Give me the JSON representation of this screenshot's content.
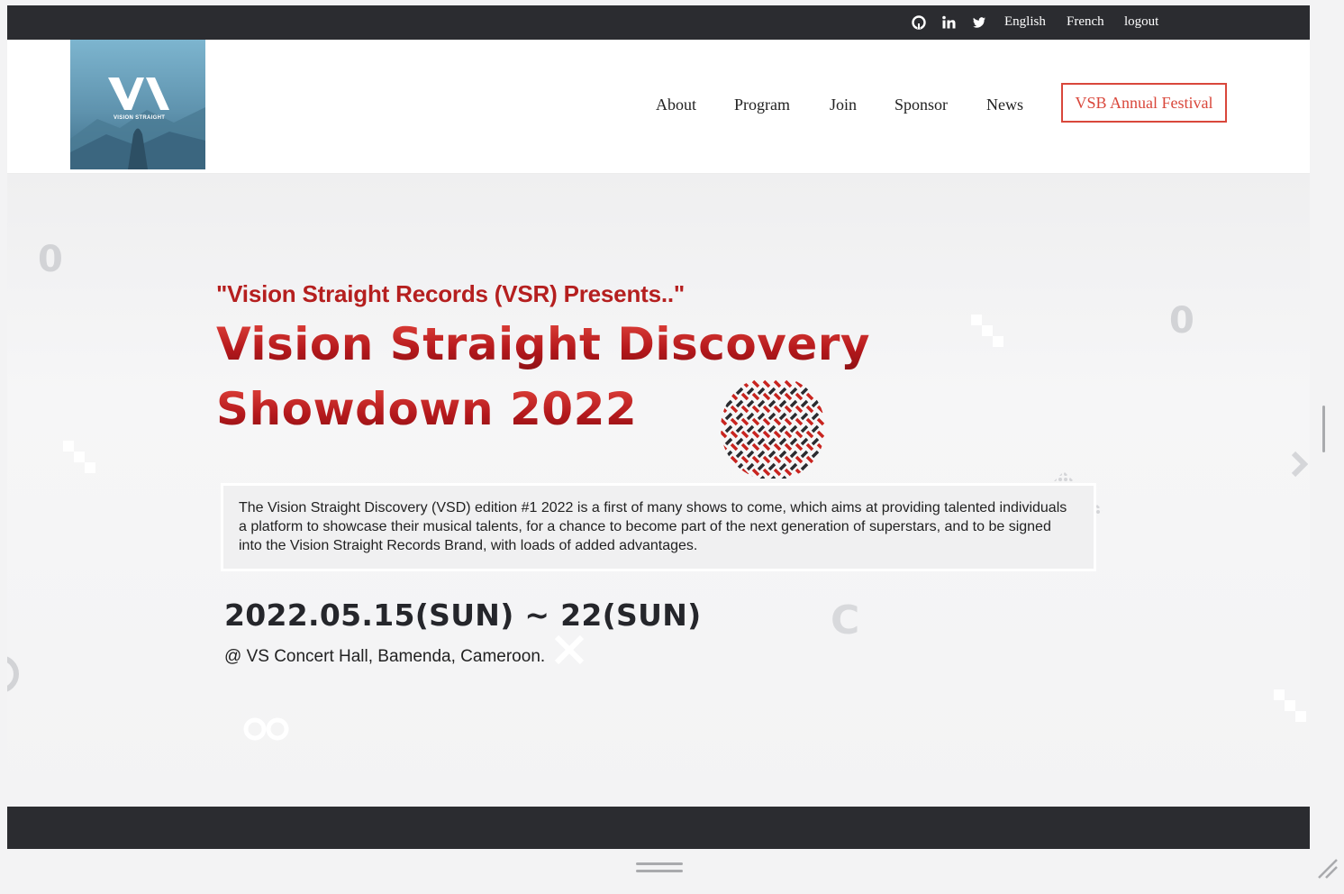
{
  "topbar": {
    "icons": [
      "github-icon",
      "linkedin-icon",
      "twitter-icon"
    ],
    "links": {
      "english": "English",
      "french": "French",
      "logout": "logout"
    }
  },
  "header": {
    "logo_text": "VISION STRAIGHT",
    "nav": [
      "About",
      "Program",
      "Join",
      "Sponsor",
      "News"
    ],
    "cta": "VSB Annual Festival"
  },
  "hero": {
    "presents": "\"Vision Straight Records (VSR) Presents..\"",
    "title_line1": "Vision Straight Discovery",
    "title_line2": "Showdown 2022",
    "description": "The Vision Straight Discovery (VSD) edition #1 2022 is a first of many shows to come, which aims at providing talented individuals a platform to showcase their musical talents, for a chance to become part of the next generation of superstars, and to be signed into the Vision Straight Records Brand, with loads of added advantages.",
    "date": "2022.05.15(SUN) ~ 22(SUN)",
    "venue": "@ VS Concert Hall, Bamenda, Cameroon."
  },
  "colors": {
    "topbar_bg": "#2b2c30",
    "accent_red": "#d9473b",
    "title_red": "#b51f1f"
  }
}
